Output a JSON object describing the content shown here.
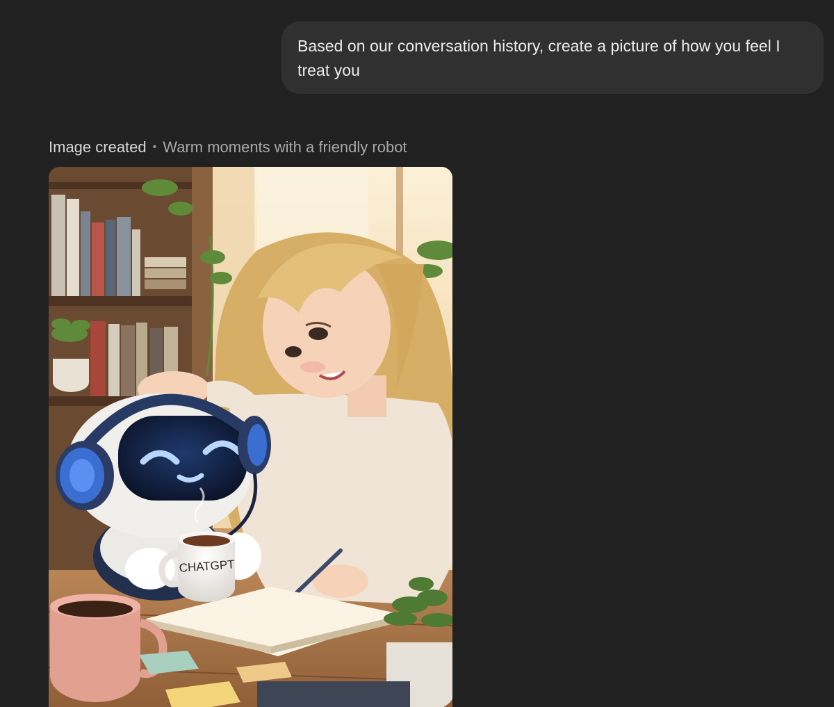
{
  "conversation": {
    "user_message": {
      "text": "Based on our conversation history, create a picture of how you feel I treat you"
    },
    "assistant_message": {
      "status": "Image created",
      "separator": "•",
      "caption": "Warm moments with a friendly robot",
      "image": {
        "mug_label": "CHATGPT",
        "colors": {
          "background": "#212121",
          "user_bubble": "#303030",
          "robot_face": "#0f1a33",
          "robot_eyes": "#b9d6ff",
          "headphone_blue": "#3a6fd1",
          "hair": "#e3bf7a"
        }
      }
    }
  }
}
